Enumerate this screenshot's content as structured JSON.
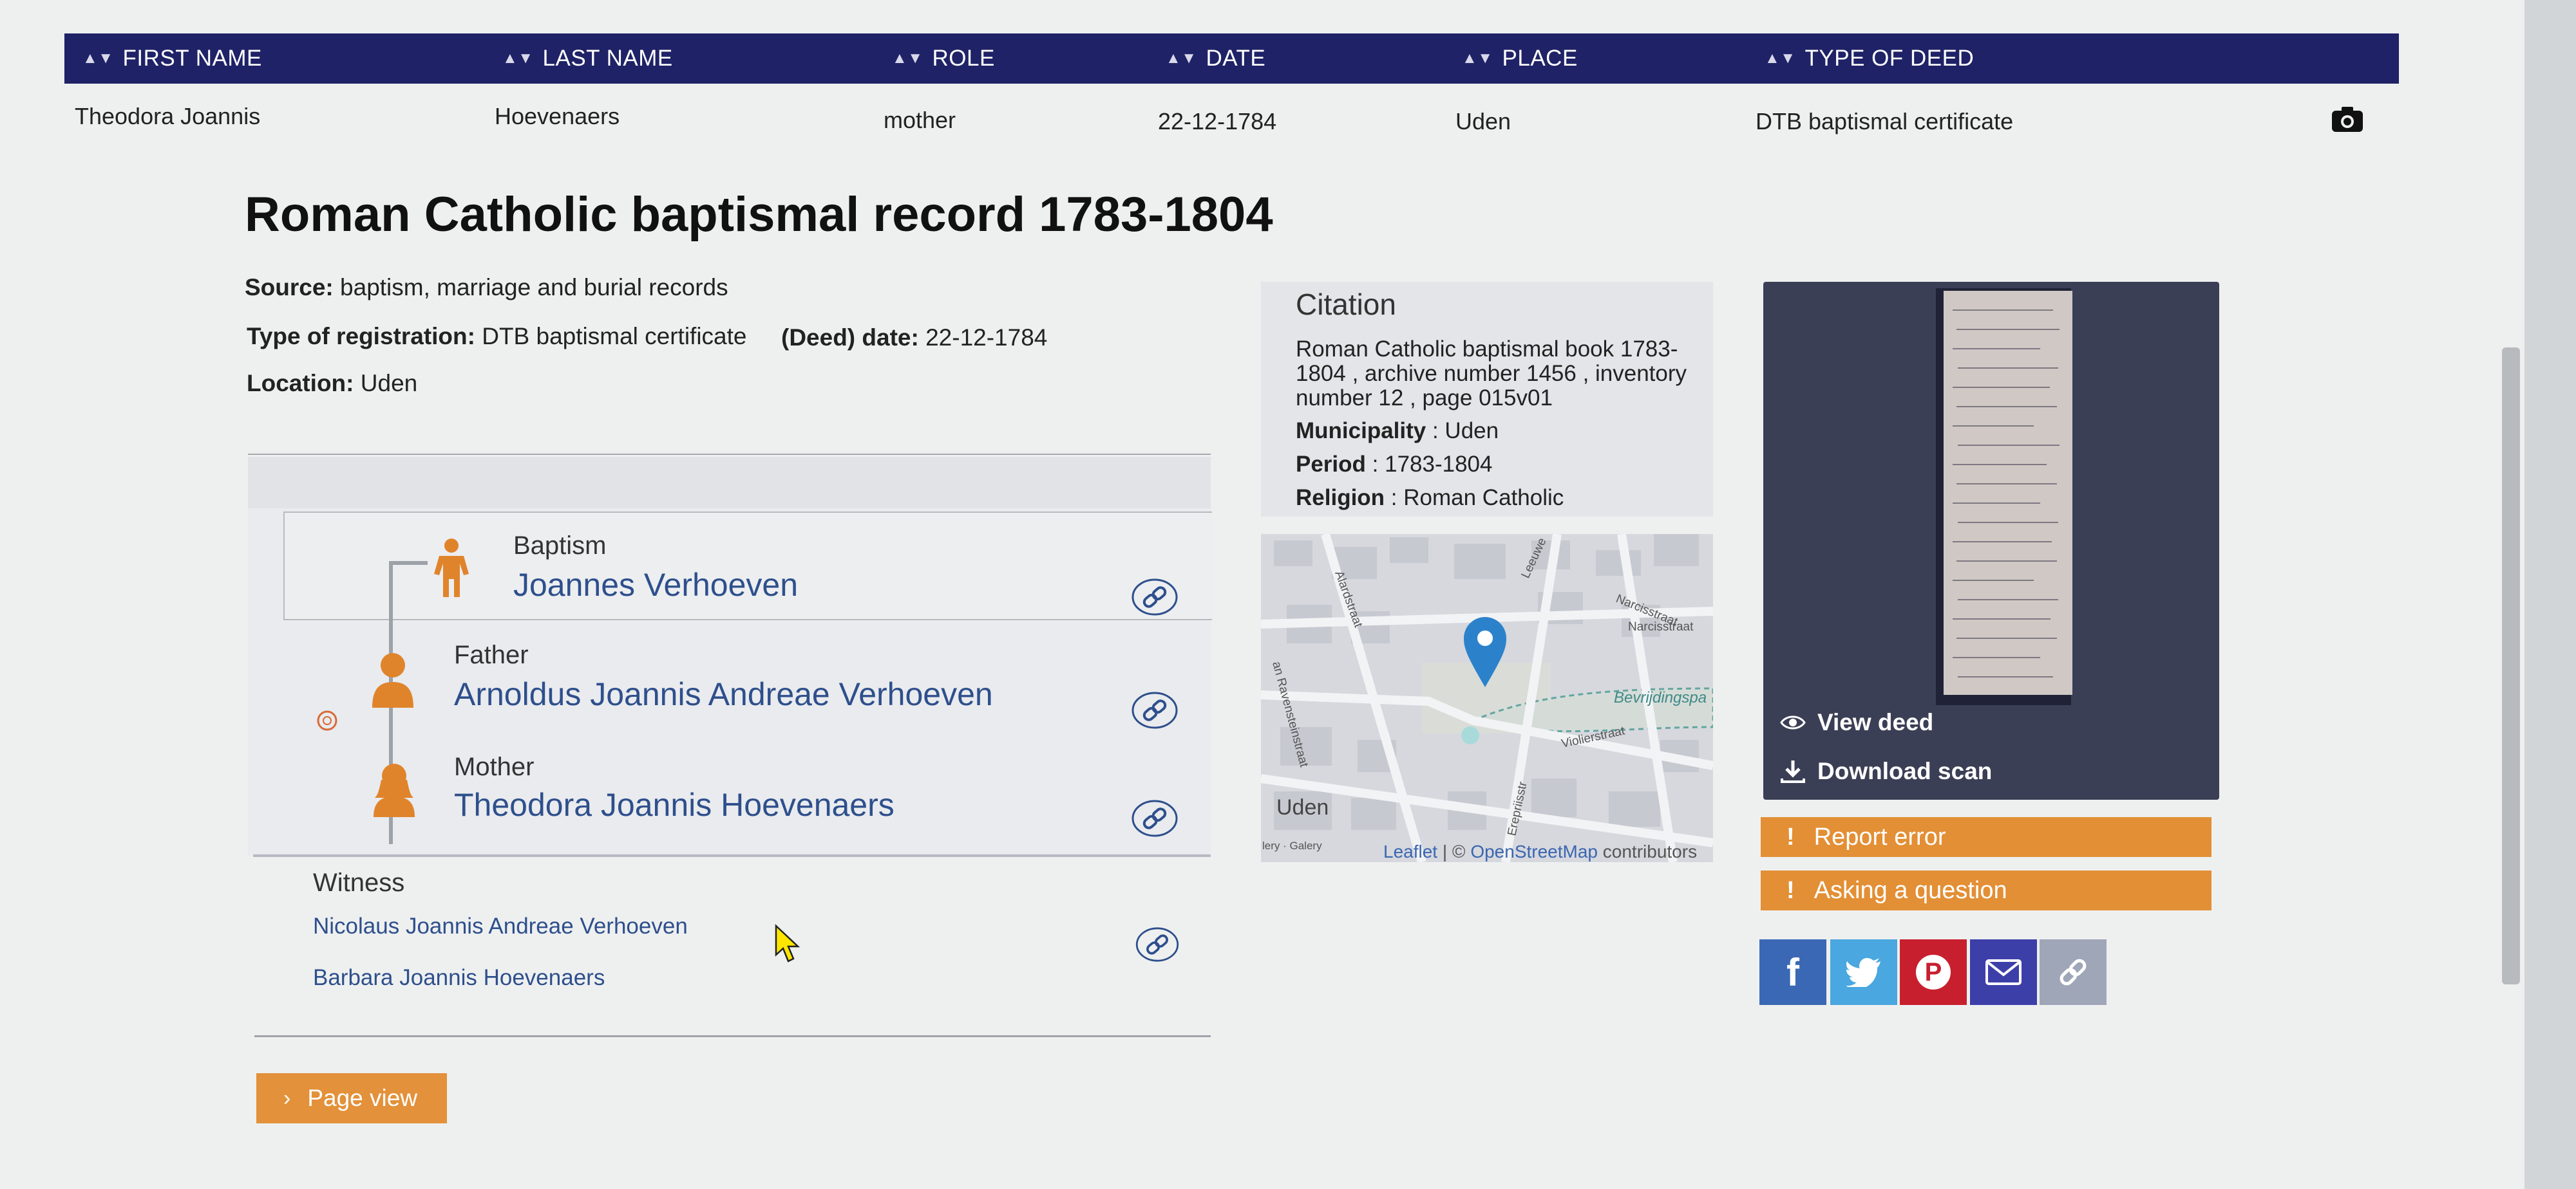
{
  "table": {
    "headers": [
      "FIRST NAME",
      "LAST NAME",
      "ROLE",
      "DATE",
      "PLACE",
      "TYPE OF DEED"
    ],
    "row": [
      "Theodora  Joannis",
      "Hoevenaers",
      "mother",
      "22-12-1784",
      "Uden",
      "DTB baptismal certificate"
    ]
  },
  "record": {
    "title": "Roman Catholic baptismal record 1783-1804",
    "source_label": "Source:",
    "source_value": "baptism, marriage and burial records",
    "type_label": "Type of registration:",
    "type_value": "DTB baptismal certificate",
    "date_label": "(Deed) date:",
    "date_value": "22-12-1784",
    "location_label": "Location:",
    "location_value": "Uden"
  },
  "persons": {
    "baptism_role": "Baptism",
    "baptism_name": "Joannes Verhoeven",
    "father_role": "Father",
    "father_name": "Arnoldus Joannis Andreae Verhoeven",
    "mother_role": "Mother",
    "mother_name": "Theodora Joannis Hoevenaers",
    "witness_role": "Witness",
    "witnesses": [
      "Nicolaus Joannis Andreae Verhoeven",
      "Barbara Joannis Hoevenaers"
    ]
  },
  "citation": {
    "title": "Citation",
    "text": "Roman Catholic baptismal book 1783-1804 , archive number 1456 , inventory number 12 , page 015v01",
    "municipality_label": "Municipality",
    "municipality_value": ": Uden",
    "period_label": "Period",
    "period_value": ": 1783-1804",
    "religion_label": "Religion",
    "religion_value": ": Roman Catholic"
  },
  "map": {
    "labels": {
      "street1": "an Ravensteinstraat",
      "street2": "Narcisstraat",
      "street3": "Narcisstraat",
      "street4": "Violierstraat",
      "street5": "Bevrijdingspa",
      "street6": "Erepriisstr",
      "street7": "Alardstraat",
      "street8": "Leeuwe",
      "town": "Uden",
      "gallery": "lery · Galery"
    },
    "credit_leaflet": "Leaflet",
    "credit_sep": " | © ",
    "credit_osm": "OpenStreetMap",
    "credit_tail": " contributors"
  },
  "deed": {
    "view_label": "View deed",
    "download_label": "Download scan"
  },
  "buttons": {
    "report": "Report error",
    "ask": "Asking a question",
    "page_view": "Page view"
  },
  "share": [
    {
      "icon": "facebook-icon",
      "color": "#3b68b5",
      "glyph": "f"
    },
    {
      "icon": "twitter-icon",
      "color": "#4aa7df"
    },
    {
      "icon": "pinterest-icon",
      "color": "#c81f2e",
      "glyph": "P"
    },
    {
      "icon": "email-icon",
      "color": "#3d3fa9"
    },
    {
      "icon": "link-icon",
      "color": "#9fa6b8"
    }
  ],
  "colors": {
    "header_bg": "#1f2266",
    "accent_orange": "#e38f35",
    "link_blue": "#2e4f8c",
    "person_icon": "#e0842c"
  }
}
